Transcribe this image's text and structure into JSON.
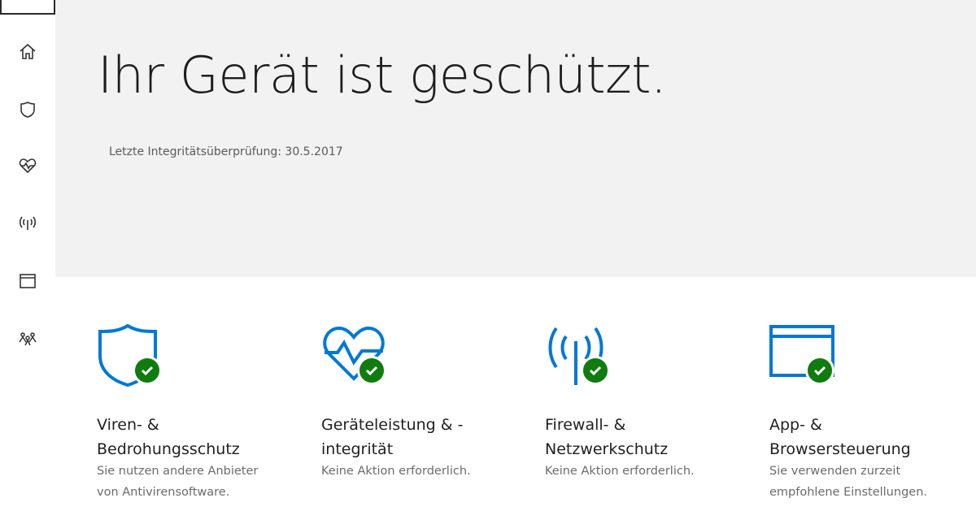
{
  "sidebar": {
    "items": [
      {
        "name": "home",
        "icon": "home-icon"
      },
      {
        "name": "virus-protection",
        "icon": "shield-icon"
      },
      {
        "name": "device-health",
        "icon": "heart-pulse-icon"
      },
      {
        "name": "firewall",
        "icon": "antenna-icon"
      },
      {
        "name": "app-browser",
        "icon": "browser-window-icon"
      },
      {
        "name": "family",
        "icon": "family-icon"
      }
    ]
  },
  "hero": {
    "title": "Ihr Gerät ist geschützt.",
    "last_check": "Letzte Integritätsüberprüfung:  30.5.2017"
  },
  "tiles": [
    {
      "icon": "shield-icon",
      "title": "Viren- &\nBedrohungsschutz",
      "desc": "Sie nutzen andere Anbieter\nvon Antivirensoftware."
    },
    {
      "icon": "heart-pulse-icon",
      "title": "Geräteleistung & -\nintegrität",
      "desc": "Keine Aktion erforderlich."
    },
    {
      "icon": "antenna-icon",
      "title": "Firewall- &\nNetzwerkschutz",
      "desc": "Keine Aktion erforderlich."
    },
    {
      "icon": "browser-window-icon",
      "title": "App- &\nBrowsersteuerung",
      "desc": "Sie verwenden zurzeit\nempfohlene Einstellungen."
    }
  ],
  "colors": {
    "accent": "#0078d7",
    "status_ok": "#107c10",
    "hero_bg": "#f2f2f2"
  }
}
